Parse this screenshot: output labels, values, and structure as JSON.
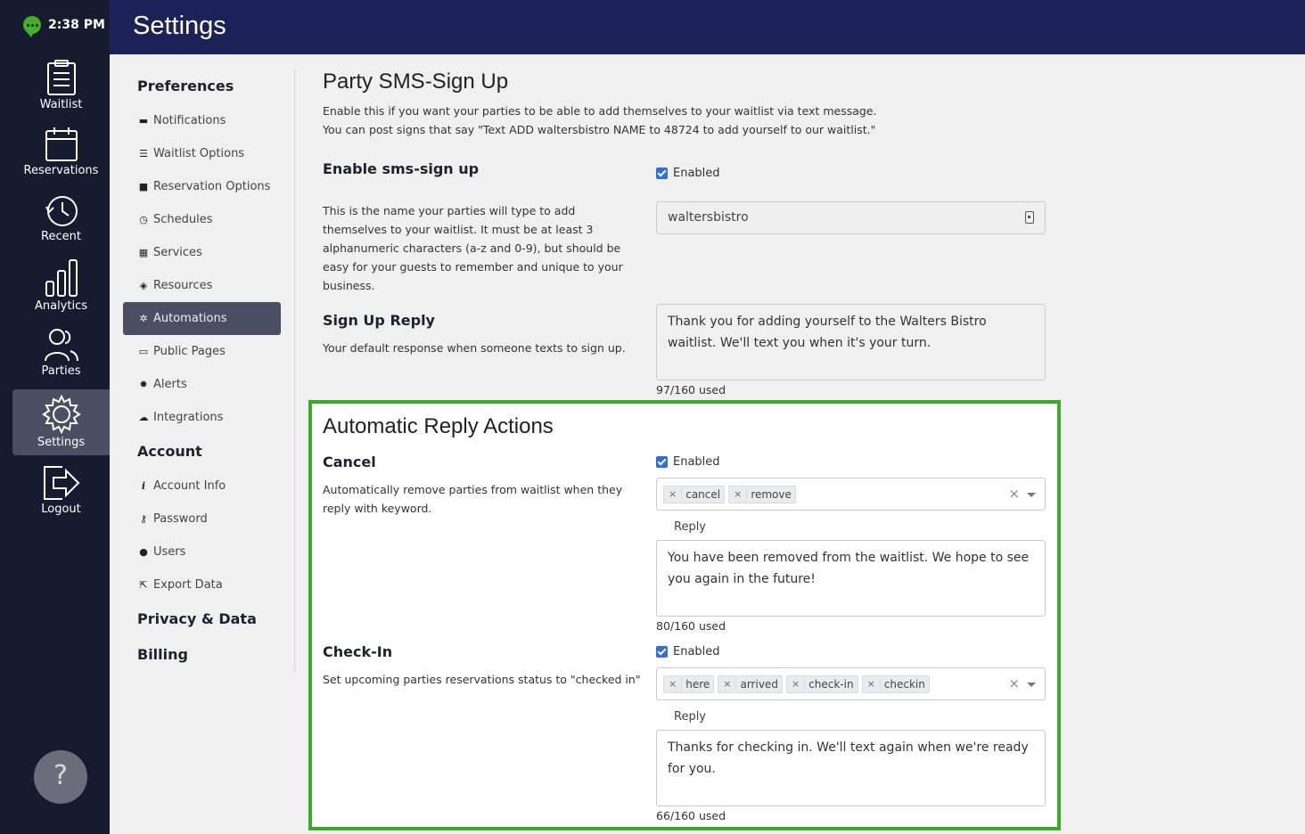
{
  "status": {
    "time": "2:38 PM"
  },
  "rail": [
    {
      "label": "Waitlist",
      "icon": "clipboard-icon"
    },
    {
      "label": "Reservations",
      "icon": "calendar-icon"
    },
    {
      "label": "Recent",
      "icon": "history-icon"
    },
    {
      "label": "Analytics",
      "icon": "bar-chart-icon"
    },
    {
      "label": "Parties",
      "icon": "users-icon"
    },
    {
      "label": "Settings",
      "icon": "gear-icon"
    },
    {
      "label": "Logout",
      "icon": "logout-icon"
    }
  ],
  "help": {
    "label": "?"
  },
  "header": {
    "title": "Settings"
  },
  "nav": {
    "preferences": "Preferences",
    "items": [
      {
        "label": "Notifications",
        "icon": "comment-icon",
        "glyph": "▬"
      },
      {
        "label": "Waitlist Options",
        "icon": "list-icon",
        "glyph": "☰"
      },
      {
        "label": "Reservation Options",
        "icon": "wallet-icon",
        "glyph": "■"
      },
      {
        "label": "Schedules",
        "icon": "clock-icon",
        "glyph": "◷"
      },
      {
        "label": "Services",
        "icon": "grid-icon",
        "glyph": "▦"
      },
      {
        "label": "Resources",
        "icon": "layers-icon",
        "glyph": "◈"
      },
      {
        "label": "Automations",
        "icon": "cog-icon",
        "glyph": "✲"
      },
      {
        "label": "Public Pages",
        "icon": "monitor-icon",
        "glyph": "▭"
      },
      {
        "label": "Alerts",
        "icon": "bug-icon",
        "glyph": "✹"
      },
      {
        "label": "Integrations",
        "icon": "cloud-icon",
        "glyph": "☁"
      }
    ],
    "account": "Account",
    "account_items": [
      {
        "label": "Account Info",
        "icon": "info-icon",
        "glyph": "i"
      },
      {
        "label": "Password",
        "icon": "key-icon",
        "glyph": "⚷"
      },
      {
        "label": "Users",
        "icon": "user-icon",
        "glyph": "●"
      },
      {
        "label": "Export Data",
        "icon": "export-icon",
        "glyph": "⇱"
      }
    ],
    "privacy": "Privacy & Data",
    "billing": "Billing"
  },
  "sms": {
    "title": "Party SMS-Sign Up",
    "desc1": "Enable this if you want your parties to be able to add themselves to your waitlist via text message.",
    "desc2": "You can post signs that say \"Text ADD waltersbistro NAME to 48724 to add yourself to our waitlist.\"",
    "enable_label": "Enable sms-sign up",
    "enabled": "Enabled",
    "name_help": "This is the name your parties will type to add themselves to your waitlist. It must be at least 3 alphanumeric characters (a-z and 0-9), but should be easy for your guests to remember and unique to your business.",
    "name_value": "waltersbistro",
    "reply_label": "Sign Up Reply",
    "reply_help": "Your default response when someone texts to sign up.",
    "reply_text": "Thank you for adding yourself to the Walters Bistro waitlist. We'll text you when it's your turn.",
    "reply_count": "97/160 used"
  },
  "auto": {
    "title": "Automatic Reply Actions",
    "cancel": {
      "label": "Cancel",
      "help": "Automatically remove parties from waitlist when they reply with keyword.",
      "enabled": "Enabled",
      "tags": [
        "cancel",
        "remove"
      ],
      "reply_label": "Reply",
      "reply_text": "You have been removed from the waitlist. We hope to see you again in the future!",
      "count": "80/160 used"
    },
    "checkin": {
      "label": "Check-In",
      "help": "Set upcoming parties reservations status to \"checked in\"",
      "enabled": "Enabled",
      "tags": [
        "here",
        "arrived",
        "check-in",
        "checkin"
      ],
      "reply_label": "Reply",
      "reply_text": "Thanks for checking in. We'll text again when we're ready for you.",
      "count": "66/160 used"
    }
  }
}
